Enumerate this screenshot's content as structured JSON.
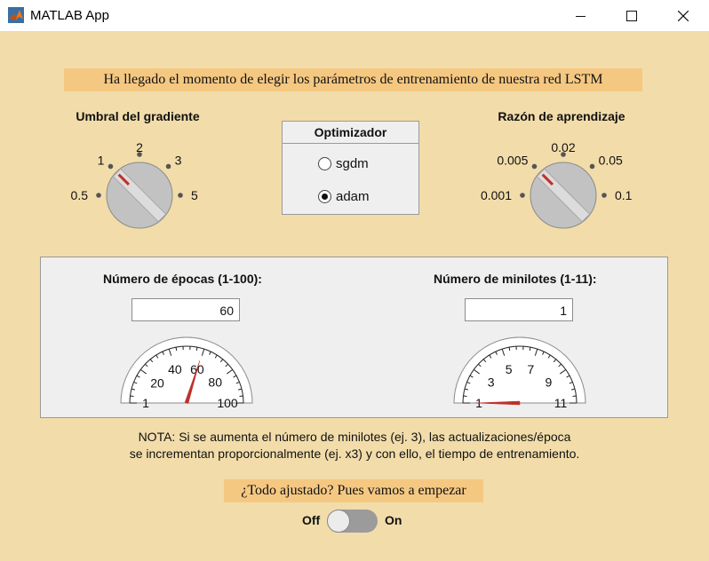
{
  "window": {
    "title": "MATLAB App",
    "buttons": [
      {
        "name": "minimize",
        "icon": "minimize-icon"
      },
      {
        "name": "maximize",
        "icon": "maximize-icon"
      },
      {
        "name": "close",
        "icon": "close-icon"
      }
    ]
  },
  "header": {
    "banner": "Ha llegado el momento de elegir los parámetros de entrenamiento de nuestra red LSTM"
  },
  "gradient_knob": {
    "title": "Umbral del gradiente",
    "options": [
      "0.5",
      "1",
      "2",
      "3",
      "5"
    ],
    "selected": "1"
  },
  "optimizer": {
    "title": "Optimizador",
    "options": [
      "sgdm",
      "adam"
    ],
    "selected": "adam"
  },
  "learning_rate_knob": {
    "title": "Razón de aprendizaje",
    "options": [
      "0.001",
      "0.005",
      "0.02",
      "0.05",
      "0.1"
    ],
    "selected": "0.005"
  },
  "epochs": {
    "label": "Número de épocas (1-100):",
    "value": "60",
    "gauge_value": 60,
    "gauge_ticks": [
      "1",
      "20",
      "40",
      "60",
      "80",
      "100"
    ]
  },
  "minibatches": {
    "label": "Número de minilotes (1-11):",
    "value": "1",
    "gauge_value": 1,
    "gauge_ticks": [
      "1",
      "3",
      "5",
      "7",
      "9",
      "11"
    ]
  },
  "note": {
    "line1": "NOTA: Si se aumenta el número de minilotes (ej. 3), las actualizaciones/época",
    "line2": "se incrementan proporcionalmente (ej. x3) y con ello, el tiempo de entrenamiento."
  },
  "start": {
    "banner": "¿Todo ajustado? Pues vamos a empezar",
    "off_label": "Off",
    "on_label": "On",
    "state": "Off"
  },
  "colors": {
    "background": "#f2dcaa",
    "banner": "#f5c882",
    "panel": "#efefef",
    "indicator": "#c0302a"
  }
}
